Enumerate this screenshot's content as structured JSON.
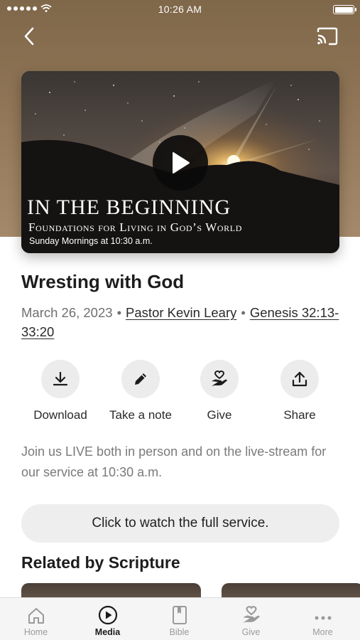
{
  "status_bar": {
    "time": "10:26 AM"
  },
  "header": {
    "back_icon": "chevron-left-icon",
    "cast_icon": "cast-icon"
  },
  "media": {
    "series_title": "IN THE BEGINNING",
    "series_subtitle": "Foundations for Living in God’s World",
    "series_schedule": "Sunday Mornings at 10:30 a.m.",
    "play_icon": "play-icon"
  },
  "sermon": {
    "title": "Wresting with God",
    "date": "March 26, 2023",
    "separator": "•",
    "speaker": "Pastor Kevin Leary",
    "scripture": "Genesis 32:13-33:20"
  },
  "actions": [
    {
      "label": "Download",
      "icon": "download-icon"
    },
    {
      "label": "Take a note",
      "icon": "pencil-icon"
    },
    {
      "label": "Give",
      "icon": "heart-hand-icon"
    },
    {
      "label": "Share",
      "icon": "share-icon"
    }
  ],
  "description": "Join us LIVE both in person and on the live-stream for our service at 10:30 a.m.",
  "watch_button": "Click to watch the full service.",
  "related": {
    "title": "Related by Scripture"
  },
  "tabs": [
    {
      "label": "Home",
      "icon": "home-icon",
      "active": false
    },
    {
      "label": "Media",
      "icon": "play-circle-icon",
      "active": true
    },
    {
      "label": "Bible",
      "icon": "bible-icon",
      "active": false
    },
    {
      "label": "Give",
      "icon": "heart-hand-icon",
      "active": false
    },
    {
      "label": "More",
      "icon": "more-dots-icon",
      "active": false
    }
  ],
  "colors": {
    "header_bg": "#94795a",
    "button_bg": "#eeeeee",
    "text_muted": "#6f6f6f"
  }
}
